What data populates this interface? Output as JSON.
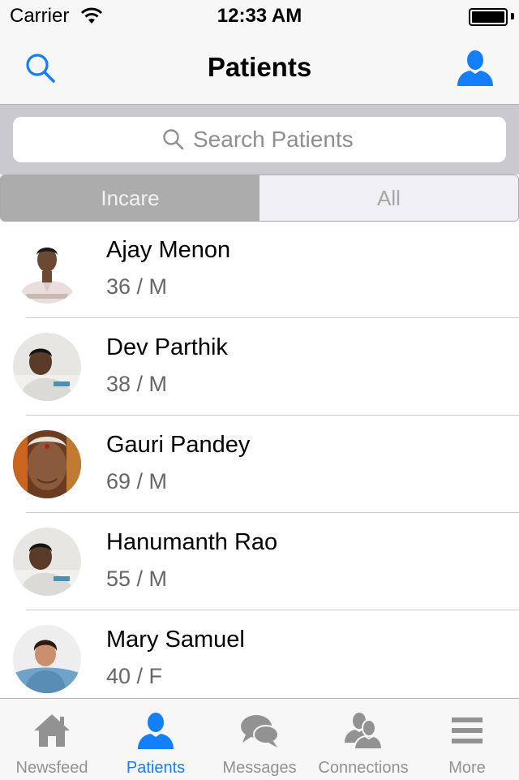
{
  "status_bar": {
    "carrier": "Carrier",
    "time": "12:33 AM"
  },
  "nav": {
    "title": "Patients"
  },
  "search": {
    "placeholder": "Search Patients"
  },
  "segments": [
    {
      "label": "Incare",
      "selected": true
    },
    {
      "label": "All",
      "selected": false
    }
  ],
  "patients": [
    {
      "name": "Ajay Menon",
      "info": "36 / M"
    },
    {
      "name": "Dev Parthik",
      "info": "38 / M"
    },
    {
      "name": "Gauri Pandey",
      "info": "69 / M"
    },
    {
      "name": "Hanumanth Rao",
      "info": "55 / M"
    },
    {
      "name": "Mary Samuel",
      "info": "40 / F"
    }
  ],
  "tabs": [
    {
      "label": "Newsfeed",
      "icon": "home-icon",
      "active": false
    },
    {
      "label": "Patients",
      "icon": "person-icon",
      "active": true
    },
    {
      "label": "Messages",
      "icon": "chat-bubbles-icon",
      "active": false
    },
    {
      "label": "Connections",
      "icon": "people-icon",
      "active": false
    },
    {
      "label": "More",
      "icon": "menu-icon",
      "active": false
    }
  ],
  "colors": {
    "accent": "#147efb",
    "inactive": "#929292",
    "segment_active": "#acacac"
  }
}
